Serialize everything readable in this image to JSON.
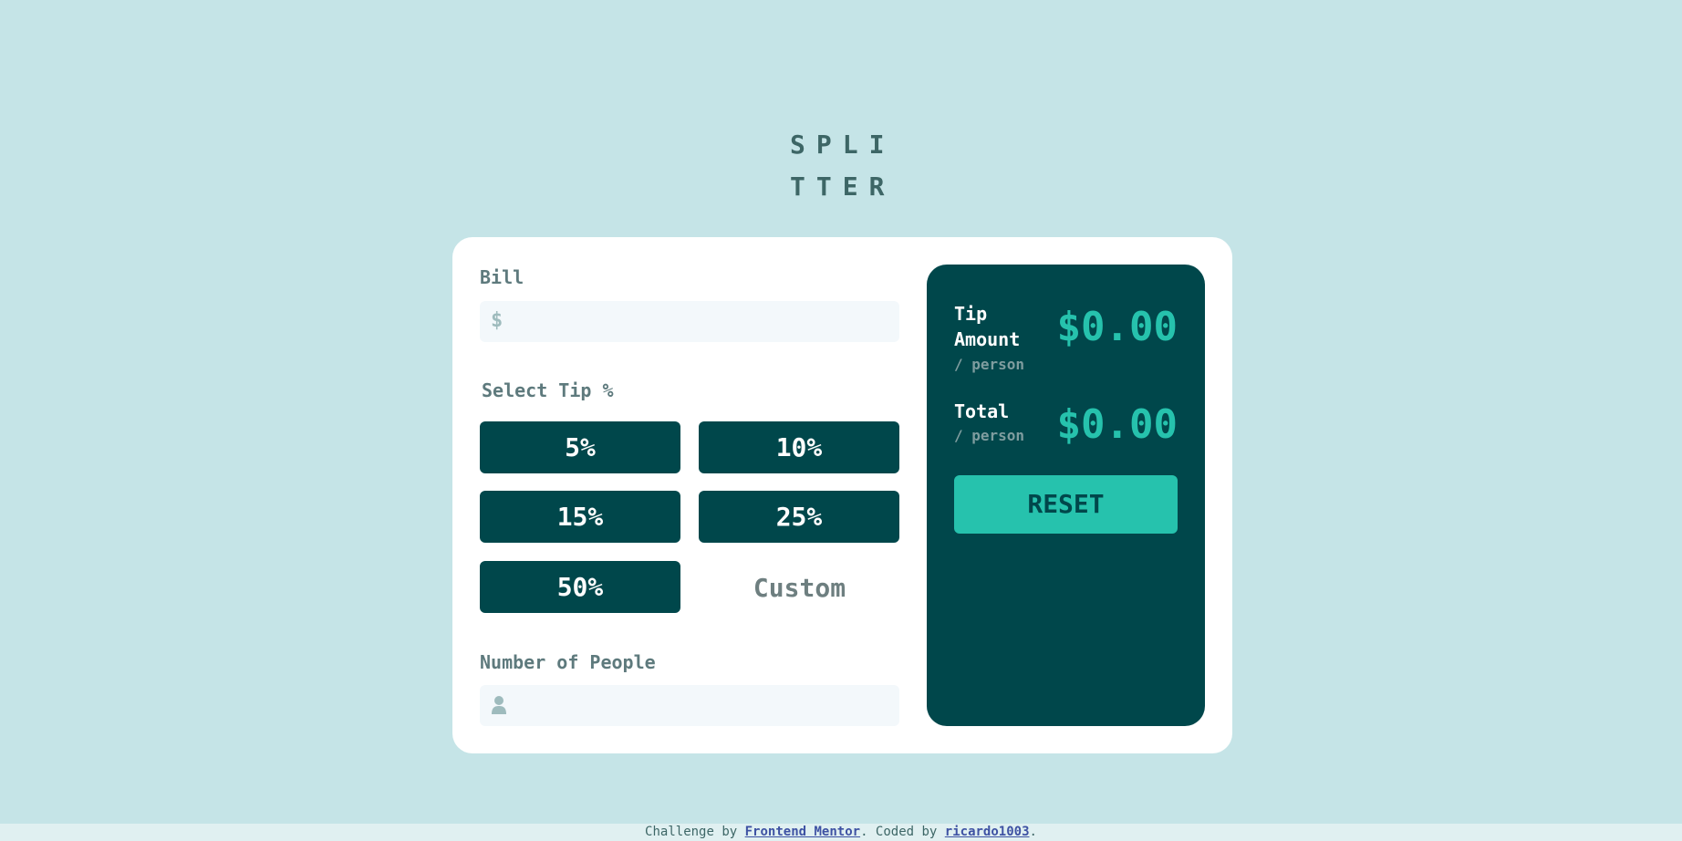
{
  "logo": "SPLITTER",
  "bill": {
    "label": "Bill",
    "currency_symbol": "$",
    "value": ""
  },
  "tip": {
    "label": "Select Tip %",
    "options": [
      "5%",
      "10%",
      "15%",
      "25%",
      "50%"
    ],
    "custom_placeholder": "Custom"
  },
  "people": {
    "label": "Number of People",
    "icon": "person-icon",
    "value": ""
  },
  "results": {
    "tip_label": "Tip Amount",
    "tip_sub": "/ person",
    "tip_value": "$0.00",
    "total_label": "Total",
    "total_sub": "/ person",
    "total_value": "$0.00",
    "reset_label": "RESET"
  },
  "footer": {
    "prefix": "Challenge by ",
    "link1": "Frontend Mentor",
    "middle": ". Coded by ",
    "link2": "ricardo1003",
    "suffix": "."
  },
  "colors": {
    "background": "#c5e4e7",
    "dark_cyan": "#00474b",
    "accent": "#26c2ad"
  }
}
